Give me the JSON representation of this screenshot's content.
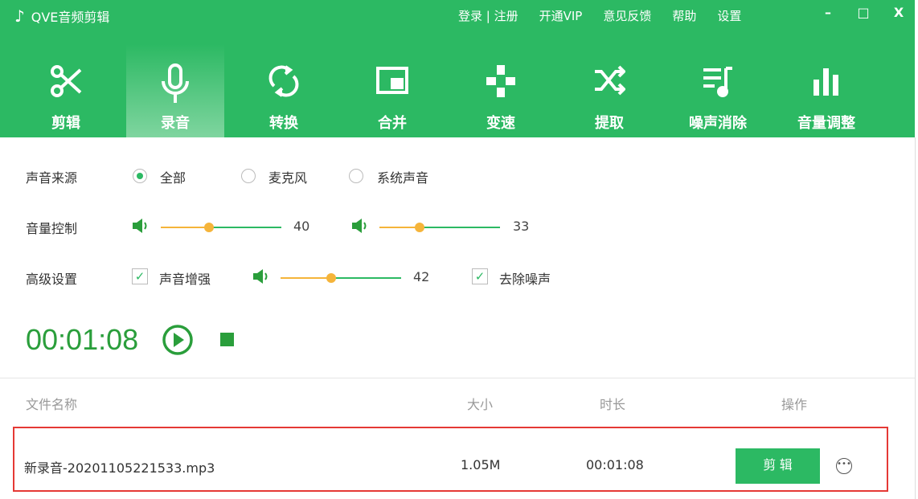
{
  "app": {
    "title": "QVE音频剪辑"
  },
  "topnav": {
    "login": "登录 | 注册",
    "vip": "开通VIP",
    "feedback": "意见反馈",
    "help": "帮助",
    "settings": "设置"
  },
  "window": {
    "minimize": "–",
    "maximize": "□",
    "close": "X"
  },
  "tabs": [
    {
      "label": "剪辑"
    },
    {
      "label": "录音"
    },
    {
      "label": "转换"
    },
    {
      "label": "合并"
    },
    {
      "label": "变速"
    },
    {
      "label": "提取"
    },
    {
      "label": "噪声消除"
    },
    {
      "label": "音量调整"
    }
  ],
  "source": {
    "label": "声音来源",
    "options": [
      "全部",
      "麦克风",
      "系统声音"
    ],
    "selected": "全部"
  },
  "volume": {
    "label": "音量控制",
    "mic": 40,
    "system": 33
  },
  "advanced": {
    "label": "高级设置",
    "enhance_label": "声音增强",
    "enhance_checked": true,
    "enhance_value": 42,
    "denoise_label": "去除噪声",
    "denoise_checked": true
  },
  "timer": "00:01:08",
  "table": {
    "headers": {
      "name": "文件名称",
      "size": "大小",
      "duration": "时长",
      "actions": "操作"
    },
    "rows": [
      {
        "name": "新录音-20201105221533.mp3",
        "size": "1.05M",
        "duration": "00:01:08",
        "edit": "剪 辑"
      }
    ]
  },
  "colors": {
    "brand": "#2cb963",
    "slider": "#f5b43a",
    "highlight": "#e53935"
  }
}
